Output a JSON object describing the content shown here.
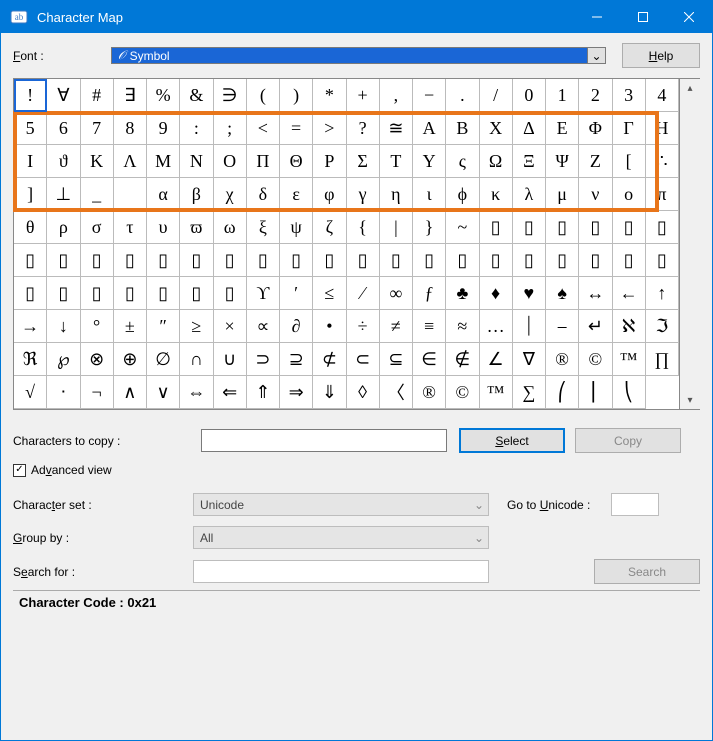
{
  "window": {
    "title": "Character Map"
  },
  "labels": {
    "font": "Font :",
    "help": "Help",
    "chars_to_copy": "Characters to copy :",
    "select": "Select",
    "copy": "Copy",
    "advanced_view": "Advanced view",
    "character_set": "Character set :",
    "go_to_unicode": "Go to Unicode :",
    "group_by": "Group by :",
    "search_for": "Search for :",
    "search": "Search"
  },
  "values": {
    "font": "Symbol",
    "characters_to_copy": "",
    "character_set": "Unicode",
    "group_by": "All",
    "go_to_unicode": "",
    "search_for": "",
    "advanced_view_checked": true
  },
  "status": "Character Code : 0x21",
  "selected_index": 0,
  "highlight": {
    "row_start": 1,
    "row_end": 3
  },
  "grid": [
    "!",
    "∀",
    "#",
    "∃",
    "%",
    "&",
    "∋",
    "(",
    ")",
    "*",
    "+",
    ",",
    "−",
    ".",
    "/",
    "0",
    "1",
    "2",
    "3",
    "4",
    "5",
    "6",
    "7",
    "8",
    "9",
    ":",
    ";",
    "<",
    "=",
    ">",
    "?",
    "≅",
    "Α",
    "Β",
    "Χ",
    "Δ",
    "Ε",
    "Φ",
    "Γ",
    "Η",
    "Ι",
    "ϑ",
    "Κ",
    "Λ",
    "Μ",
    "Ν",
    "Ο",
    "Π",
    "Θ",
    "Ρ",
    "Σ",
    "Τ",
    "Υ",
    "ς",
    "Ω",
    "Ξ",
    "Ψ",
    "Ζ",
    "[",
    "∴",
    "]",
    "⊥",
    "_",
    " ",
    "α",
    "β",
    "χ",
    "δ",
    "ε",
    "φ",
    "γ",
    "η",
    "ι",
    "ϕ",
    "κ",
    "λ",
    "μ",
    "ν",
    "ο",
    "π",
    "θ",
    "ρ",
    "σ",
    "τ",
    "υ",
    "ϖ",
    "ω",
    "ξ",
    "ψ",
    "ζ",
    "{",
    "|",
    "}",
    "~",
    "▯",
    "▯",
    "▯",
    "▯",
    "▯",
    "▯",
    "▯",
    "▯",
    "▯",
    "▯",
    "▯",
    "▯",
    "▯",
    "▯",
    "▯",
    "▯",
    "▯",
    "▯",
    "▯",
    "▯",
    "▯",
    "▯",
    "▯",
    "▯",
    "▯",
    "▯",
    "▯",
    "▯",
    "▯",
    "▯",
    "▯",
    "▯",
    "▯",
    "ϒ",
    "′",
    "≤",
    "⁄",
    "∞",
    "ƒ",
    "♣",
    "♦",
    "♥",
    "♠",
    "↔",
    "←",
    "↑",
    "→",
    "↓",
    "°",
    "±",
    "″",
    "≥",
    "×",
    "∝",
    "∂",
    "•",
    "÷",
    "≠",
    "≡",
    "≈",
    "…",
    "⏐",
    "⎯",
    "↵",
    "ℵ",
    "ℑ",
    "ℜ",
    "℘",
    "⊗",
    "⊕",
    "∅",
    "∩",
    "∪",
    "⊃",
    "⊇",
    "⊄",
    "⊂",
    "⊆",
    "∈",
    "∉",
    "∠",
    "∇",
    "®",
    "©",
    "™",
    "∏",
    "√",
    "⋅",
    "¬",
    "∧",
    "∨",
    "⇔",
    "⇐",
    "⇑",
    "⇒",
    "⇓",
    "◊",
    "〈",
    "®",
    "©",
    "™",
    "∑",
    "⎛",
    "⎜",
    "⎝"
  ]
}
